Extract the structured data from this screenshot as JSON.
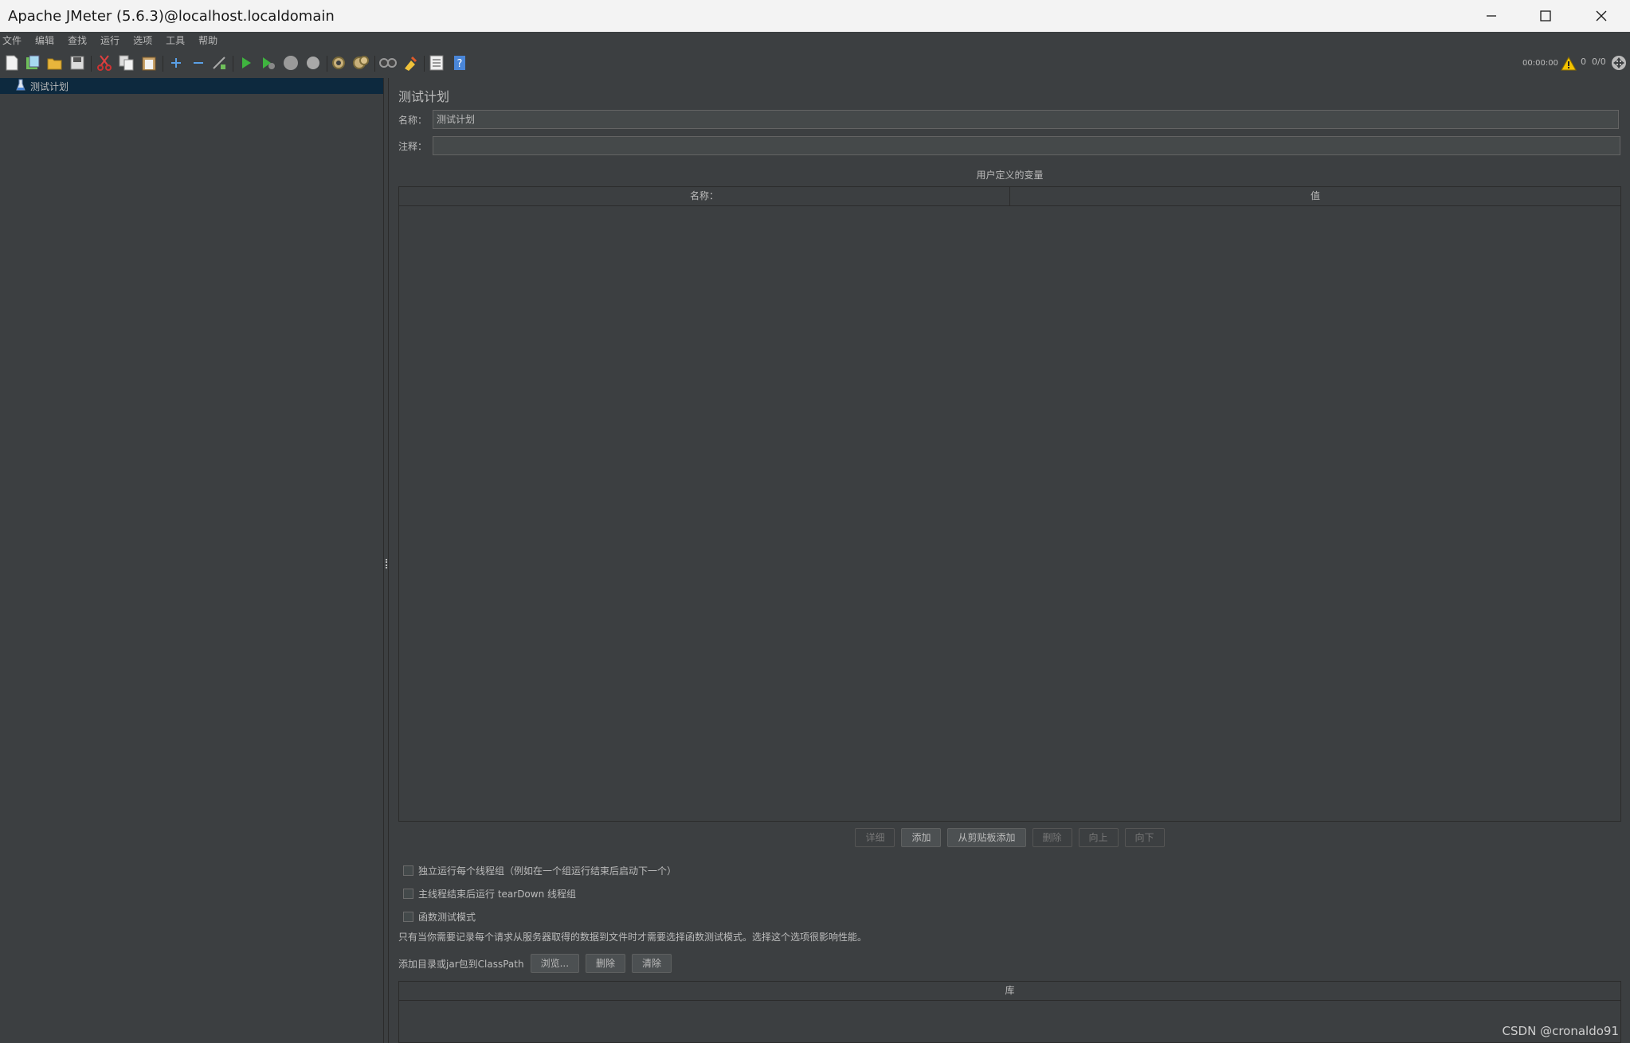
{
  "window": {
    "title": "Apache JMeter (5.6.3)@localhost.localdomain"
  },
  "menu": {
    "items": [
      "文件",
      "编辑",
      "查找",
      "运行",
      "选项",
      "工具",
      "帮助"
    ]
  },
  "toolbar": {
    "icons": [
      "new-icon",
      "templates-icon",
      "open-icon",
      "save-icon",
      "cut-icon",
      "copy-icon",
      "paste-icon",
      "expand-icon",
      "collapse-icon",
      "toggle-icon",
      "start-icon",
      "start-no-pause-icon",
      "stop-icon",
      "shutdown-icon",
      "clear-icon",
      "clear-all-icon",
      "search-icon",
      "reset-search-icon",
      "function-helper-icon",
      "help-icon"
    ],
    "timer": "00:00:00",
    "warning_count": "0",
    "threads": "0/0"
  },
  "tree": {
    "items": [
      {
        "label": "测试计划",
        "selected": true
      }
    ]
  },
  "test_plan": {
    "heading": "测试计划",
    "name_label": "名称：",
    "name_value": "测试计划",
    "comment_label": "注释：",
    "comment_value": "",
    "variables_title": "用户定义的变量",
    "columns": [
      "名称：",
      "值"
    ],
    "rows": [],
    "buttons": [
      {
        "label": "详细",
        "enabled": false
      },
      {
        "label": "添加",
        "enabled": true
      },
      {
        "label": "从剪贴板添加",
        "enabled": true
      },
      {
        "label": "删除",
        "enabled": false
      },
      {
        "label": "向上",
        "enabled": false
      },
      {
        "label": "向下",
        "enabled": false
      }
    ],
    "checkboxes": [
      {
        "label": "独立运行每个线程组（例如在一个组运行结束后启动下一个）",
        "checked": false
      },
      {
        "label": "主线程结束后运行 tearDown 线程组",
        "checked": false
      },
      {
        "label": "函数测试模式",
        "checked": false
      }
    ],
    "functional_note": "只有当你需要记录每个请求从服务器取得的数据到文件时才需要选择函数测试模式。选择这个选项很影响性能。",
    "classpath_label": "添加目录或jar包到ClassPath",
    "classpath_buttons": [
      "浏览...",
      "删除",
      "清除"
    ],
    "library_column": "库"
  },
  "watermark": "CSDN @cronaldo91"
}
